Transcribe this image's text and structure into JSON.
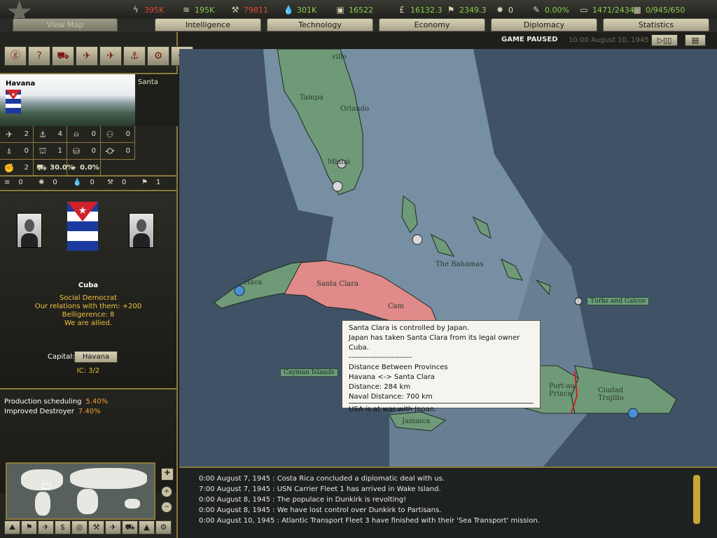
{
  "resources": [
    {
      "icon": "energy-icon",
      "glyph": "ϟ",
      "value": "395K",
      "color": "#e04a3a"
    },
    {
      "icon": "metal-icon",
      "glyph": "≋",
      "value": "195K",
      "color": "#8ad04a"
    },
    {
      "icon": "rare-materials-icon",
      "glyph": "⚒",
      "value": "79811",
      "color": "#e04a3a"
    },
    {
      "icon": "oil-icon",
      "glyph": "💧",
      "value": "301K",
      "color": "#8ad04a"
    },
    {
      "icon": "supplies-icon",
      "glyph": "▣",
      "value": "16522",
      "color": "#8ad04a"
    },
    {
      "icon": "money-icon",
      "glyph": "£",
      "value": "16132.3",
      "color": "#8ad04a"
    },
    {
      "icon": "ic-factory-icon",
      "glyph": "⚑",
      "value": "2349.3",
      "color": "#8ad04a"
    },
    {
      "icon": "nuke-icon",
      "glyph": "✹",
      "value": "0",
      "color": "#e8e2c8"
    },
    {
      "icon": "dissent-icon",
      "glyph": "✎",
      "value": "0.00%",
      "color": "#8ad04a"
    },
    {
      "icon": "transports-icon",
      "glyph": "▭",
      "value": "1471/2434",
      "color": "#8ad04a"
    },
    {
      "icon": "manpower-icon",
      "glyph": "▦",
      "value": "0/945/650",
      "color": "#8ad04a"
    }
  ],
  "tabs": {
    "view_map": "View Map",
    "intelligence": "Intelligence",
    "technology": "Technology",
    "economy": "Economy",
    "diplomacy": "Diplomacy",
    "statistics": "Statistics"
  },
  "status": {
    "paused": "GAME PAUSED",
    "datetime": "10:00 August 10, 1945",
    "play_pause_glyph": "▷▯▯",
    "menu_glyph": "▤"
  },
  "province": {
    "name": "Havana",
    "neighbor": "Santa",
    "stats": [
      {
        "icon": "airbase-icon",
        "glyph": "✈",
        "value": "2"
      },
      {
        "icon": "naval-base-icon",
        "glyph": "⚓",
        "value": "4"
      },
      {
        "icon": "anti-air-icon",
        "glyph": "⍝",
        "value": "0"
      },
      {
        "icon": "radar-icon",
        "glyph": "⚇",
        "value": "0"
      },
      {
        "icon": "fort-icon",
        "glyph": "⍋",
        "value": "0"
      },
      {
        "icon": "coastal-fort-icon",
        "glyph": "⛫",
        "value": "1"
      },
      {
        "icon": "infrastructure-icon",
        "glyph": "⛁",
        "value": "0"
      },
      {
        "icon": "rocket-site-icon",
        "glyph": "⛮",
        "value": "0"
      },
      {
        "icon": "partisan-icon",
        "glyph": "✊",
        "value": "2"
      },
      {
        "icon": "infra-percent-icon",
        "glyph": "⛟",
        "value": "30.0%"
      },
      {
        "icon": "revolt-icon",
        "glyph": "✦",
        "value": "0.0%"
      }
    ],
    "resources": [
      {
        "icon": "metal-res-icon",
        "glyph": "≋",
        "value": "0"
      },
      {
        "icon": "energy-res-icon",
        "glyph": "✺",
        "value": "0"
      },
      {
        "icon": "oil-res-icon",
        "glyph": "💧",
        "value": "0"
      },
      {
        "icon": "rare-res-icon",
        "glyph": "⚒",
        "value": "0"
      },
      {
        "icon": "ic-res-icon",
        "glyph": "⚑",
        "value": "1"
      }
    ]
  },
  "country": {
    "name": "Cuba",
    "government": "Social Democrat",
    "relations": "Our relations with them: +200",
    "belligerence": "Belligerence: 8",
    "allied": "We are allied.",
    "capital_label": "Capital:",
    "capital": "Havana",
    "ic": "IC: 3/2"
  },
  "tech": [
    {
      "name": "Production scheduling",
      "pct": "5.40%"
    },
    {
      "name": "Improved Destroyer",
      "pct": "7.40%"
    }
  ],
  "unit_buttons": [
    "ⓖ",
    "?",
    "⛟",
    "✈",
    "✈",
    "⚓",
    "⚙",
    "✈"
  ],
  "map_modes": [
    "⛰",
    "⚑",
    "✈",
    "$",
    "◎",
    "⚒",
    "✈",
    "⛟",
    "▲",
    "⚙"
  ],
  "zoom": {
    "in": "+",
    "out": "−",
    "center": "✚"
  },
  "map_labels": {
    "tampa": "Tampa",
    "orlando": "Orlando",
    "miami": "Miami",
    "ville": "ville",
    "bahamas": "The Bahamas",
    "havana_map": "Hava",
    "santa_clara_map": "Santa Clara",
    "camaguey_map": "Cam",
    "turks": "Turks and Caicos",
    "cayman": "Cayman Islands",
    "jamaica": "Jamaica",
    "port_prince": "Port-au-Prince",
    "ciudad_trujillo": "Ciudad Trujillo"
  },
  "tooltip": {
    "line1": "Santa Clara is controlled by Japan.",
    "line2": "Japan has taken Santa Clara from its legal owner Cuba.",
    "dashes": "-------------------------",
    "distance_title": "Distance Between Provinces",
    "pair": "Havana <-> Santa Clara",
    "distance": "Distance: 284 km",
    "naval": "Naval Distance: 700 km",
    "war": "USA is at war with Japan."
  },
  "messages": [
    "0:00 August 7, 1945 : Costa Rica concluded a diplomatic deal with us.",
    "7:00 August 7, 1945 : USN Carrier Fleet 1 has arrived in Wake Island.",
    "0:00 August 8, 1945 : The populace in Dunkirk is revolting!",
    "0:00 August 8, 1945 : We have lost control over Dunkirk to Partisans.",
    "0:00 August 10, 1945 : Atlantic Transport Fleet 3 have finished with their 'Sea Transport' mission."
  ],
  "colors": {
    "usa_sea_zone": "#8aa4b8",
    "friendly_land": "#6f9a78",
    "enemy_land": "#e08a8a",
    "accent_gold": "#8a7a3a"
  }
}
